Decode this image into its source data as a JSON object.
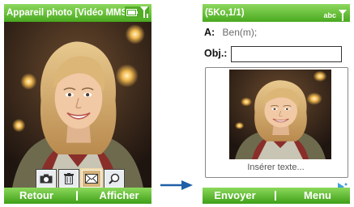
{
  "left": {
    "title": "Appareil photo [Vidéo MMS",
    "toolbar": {
      "buttons": [
        {
          "icon": "camera-icon",
          "selected": false
        },
        {
          "icon": "trash-icon",
          "selected": false
        },
        {
          "icon": "envelope-icon",
          "selected": true
        },
        {
          "icon": "magnifier-icon",
          "selected": false
        }
      ]
    },
    "softkeys": {
      "left": "Retour",
      "right": "Afficher"
    }
  },
  "right": {
    "title": "(5Ko,1/1)",
    "input_mode": "abc",
    "to_label": "A:",
    "to_value": "Ben(m);",
    "subject_label": "Obj.:",
    "subject_value": "",
    "insert_text": "Insérer texte...",
    "softkeys": {
      "left": "Envoyer",
      "right": "Menu"
    }
  },
  "colors": {
    "title_bar": "#5cb52c",
    "soft_bar": "#4aa91f"
  }
}
